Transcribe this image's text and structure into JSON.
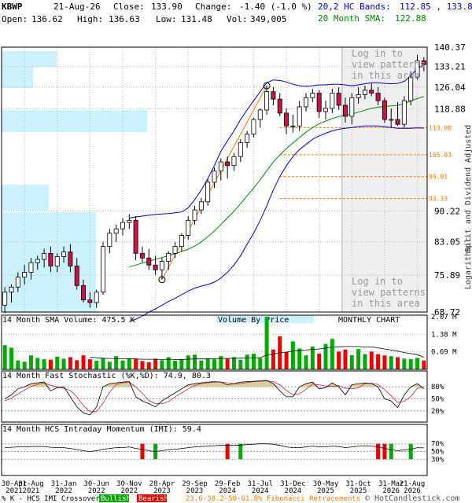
{
  "header": {
    "symbol": "KBWP",
    "date": "21-Aug-26",
    "close_label": "Close:",
    "close": "133.90",
    "change_label": "Change:",
    "change": "-1.40 (-1.0 %)",
    "open_label": "Open:",
    "open": "136.62",
    "high_label": "High:",
    "high": "136.63",
    "low_label": "Low:",
    "low": "131.48",
    "vol_label": "Vol:",
    "vol": "349,005",
    "bands_label": "20,2 HC Bands:",
    "bands_value": "112.85 , 133.81",
    "sma_label": "20 Month SMA:",
    "sma_value": "122.88"
  },
  "colors": {
    "up": "#00aa00",
    "down": "#ee0000",
    "candle_down": "#cc1144",
    "band": "#0000cc",
    "sma": "#008800",
    "fib": "#ff7700",
    "vbp": "#ccf2ff",
    "shade": "#efefef",
    "watermark": "#999999",
    "grid": "#bbbbbb"
  },
  "watermark": {
    "top": [
      "Log in to",
      "view patterns",
      "in this area"
    ],
    "bottom": [
      "Log in to",
      "view patterns",
      "in this area"
    ]
  },
  "side_labels": {
    "right": "Split and Dividend Adjusted",
    "scale": "Logarithmic"
  },
  "chart_data": [
    {
      "type": "candlestick",
      "panel": "price",
      "scale": "log",
      "ylim": [
        68.72,
        140.37
      ],
      "y_ticks": [
        "140.37",
        "133.21",
        "126.04",
        "118.88",
        "90.22",
        "83.05",
        "75.89",
        "68.72"
      ],
      "fib_labels": [
        "113.00",
        "105.03",
        "99.01",
        "93.33"
      ],
      "fib_values": [
        113.0,
        105.03,
        99.01,
        93.33
      ],
      "x": [
        "Apr 2021",
        "May 2021",
        "Jun 2021",
        "Jul 2021",
        "Aug 2021",
        "Sep 2021",
        "Oct 2021",
        "Nov 2021",
        "Dec 2021",
        "Jan 2022",
        "Feb 2022",
        "Mar 2022",
        "Apr 2022",
        "May 2022",
        "Jun 2022",
        "Jul 2022",
        "Aug 2022",
        "Sep 2022",
        "Oct 2022",
        "Nov 2022",
        "Dec 2022",
        "Jan 2023",
        "Feb 2023",
        "Mar 2023",
        "Apr 2023",
        "May 2023",
        "Jun 2023",
        "Jul 2023",
        "Aug 2023",
        "Sep 2023",
        "Oct 2023",
        "Nov 2023",
        "Dec 2023",
        "Jan 2024",
        "Feb 2024",
        "Mar 2024",
        "Apr 2024",
        "May 2024",
        "Jun 2024",
        "Jul 2024",
        "Aug 2024",
        "Sep 2024",
        "Oct 2024",
        "Nov 2024",
        "Dec 2024",
        "Jan 2025",
        "Feb 2025",
        "Mar 2025",
        "Apr 2025",
        "May 2025",
        "Jun 2025",
        "Jul 2025",
        "Aug 2025",
        "Sep 2025",
        "Oct 2025",
        "Nov 2025",
        "Dec 2025",
        "Jan 2026",
        "Feb 2026",
        "Mar 2026",
        "Apr 2026",
        "May 2026",
        "Jun 2026",
        "Jul 2026",
        "Aug 2026"
      ],
      "open": [
        70.0,
        72.5,
        73.5,
        75.5,
        76.5,
        78.5,
        79.2,
        80.5,
        77.8,
        79.8,
        80.8,
        77.8,
        73.8,
        71.0,
        70.5,
        72.5,
        82.0,
        85.0,
        86.0,
        87.5,
        88.0,
        80.5,
        79.5,
        78.0,
        77.0,
        78.8,
        80.5,
        82.0,
        84.5,
        88.0,
        90.5,
        92.5,
        97.5,
        100.5,
        103.0,
        102.0,
        104.5,
        108.5,
        111.0,
        115.5,
        118.5,
        124.5,
        122.0,
        117.5,
        113.5,
        113.5,
        119.5,
        122.5,
        124.0,
        118.0,
        119.0,
        124.0,
        120.0,
        116.5,
        122.5,
        123.5,
        125.0,
        124.0,
        121.5,
        115.5,
        115.5,
        114.0,
        121.5,
        129.5,
        135.3
      ],
      "high": [
        73.5,
        74.0,
        76.5,
        78.0,
        79.5,
        80.0,
        81.5,
        82.0,
        80.5,
        82.0,
        82.5,
        79.5,
        75.0,
        72.5,
        73.0,
        83.0,
        86.0,
        87.0,
        88.5,
        89.5,
        89.0,
        82.0,
        81.5,
        80.0,
        79.5,
        81.0,
        83.0,
        85.0,
        89.0,
        91.5,
        93.5,
        98.5,
        101.5,
        104.0,
        104.5,
        105.5,
        109.5,
        112.0,
        116.0,
        119.0,
        126.5,
        126.0,
        124.0,
        119.0,
        117.0,
        121.5,
        124.0,
        125.5,
        125.0,
        121.5,
        125.5,
        126.0,
        122.5,
        124.0,
        126.0,
        126.5,
        127.5,
        126.0,
        122.5,
        119.0,
        121.0,
        123.0,
        131.5,
        137.5,
        136.6
      ],
      "low": [
        68.5,
        70.5,
        72.5,
        74.0,
        75.0,
        77.0,
        77.5,
        76.5,
        76.5,
        78.5,
        76.5,
        73.0,
        70.5,
        69.5,
        69.5,
        72.0,
        80.5,
        83.0,
        84.5,
        86.0,
        79.0,
        78.5,
        77.0,
        76.0,
        75.0,
        77.0,
        79.5,
        81.0,
        83.5,
        87.0,
        89.5,
        91.5,
        96.0,
        98.0,
        98.5,
        100.5,
        103.0,
        107.0,
        110.0,
        113.0,
        117.0,
        120.0,
        116.5,
        111.0,
        111.5,
        112.0,
        118.0,
        121.0,
        116.0,
        115.5,
        117.5,
        118.5,
        114.5,
        114.0,
        120.5,
        122.0,
        123.0,
        120.0,
        114.5,
        113.0,
        113.5,
        113.0,
        120.0,
        128.5,
        131.5
      ],
      "close": [
        72.5,
        73.5,
        75.5,
        76.5,
        78.5,
        79.2,
        80.5,
        77.8,
        79.8,
        80.8,
        77.8,
        73.8,
        71.0,
        70.5,
        72.5,
        82.0,
        85.0,
        86.0,
        87.5,
        88.0,
        80.5,
        79.5,
        78.0,
        77.0,
        78.8,
        80.5,
        82.0,
        84.5,
        88.0,
        90.5,
        92.5,
        97.5,
        100.5,
        103.0,
        102.0,
        104.5,
        108.5,
        111.0,
        115.5,
        118.5,
        124.5,
        122.0,
        117.5,
        113.5,
        113.5,
        119.5,
        122.5,
        124.0,
        118.0,
        119.0,
        124.0,
        120.0,
        116.5,
        122.5,
        123.5,
        125.0,
        124.0,
        121.5,
        115.5,
        115.5,
        114.0,
        121.5,
        129.5,
        135.3,
        133.9
      ],
      "sma20": [
        null,
        null,
        null,
        null,
        null,
        null,
        null,
        null,
        null,
        null,
        null,
        null,
        null,
        null,
        null,
        null,
        null,
        null,
        null,
        77.6,
        78.0,
        78.4,
        78.8,
        79.2,
        79.6,
        80.0,
        80.4,
        80.9,
        81.4,
        82.1,
        83.0,
        84.2,
        85.5,
        87.0,
        88.6,
        90.2,
        92.0,
        94.0,
        96.0,
        98.2,
        100.6,
        103.0,
        105.0,
        106.8,
        108.4,
        110.0,
        111.6,
        113.0,
        114.2,
        115.0,
        115.8,
        116.4,
        116.8,
        117.2,
        117.8,
        118.4,
        119.0,
        119.4,
        119.6,
        119.8,
        120.0,
        120.6,
        121.4,
        122.2,
        122.9
      ],
      "band_upper": [
        null,
        null,
        null,
        null,
        null,
        null,
        null,
        null,
        null,
        null,
        null,
        null,
        null,
        null,
        null,
        null,
        null,
        null,
        null,
        88.5,
        88.8,
        89.0,
        89.2,
        89.4,
        89.5,
        89.6,
        89.8,
        90.0,
        91.0,
        93.0,
        95.5,
        98.5,
        102.0,
        106.0,
        109.0,
        112.0,
        115.5,
        118.5,
        121.5,
        124.5,
        127.5,
        128.5,
        128.3,
        127.8,
        127.0,
        126.5,
        126.3,
        126.5,
        126.8,
        126.8,
        127.0,
        127.0,
        126.8,
        126.5,
        126.8,
        127.2,
        127.5,
        127.5,
        127.3,
        127.2,
        127.3,
        128.0,
        130.0,
        132.5,
        133.8
      ],
      "band_lower": [
        null,
        null,
        null,
        null,
        null,
        null,
        null,
        null,
        null,
        null,
        null,
        null,
        null,
        null,
        null,
        null,
        null,
        null,
        null,
        67.0,
        67.4,
        68.0,
        68.7,
        69.3,
        70.0,
        70.7,
        71.3,
        72.0,
        72.7,
        73.3,
        73.7,
        74.0,
        74.5,
        75.3,
        76.5,
        78.0,
        80.0,
        82.5,
        85.0,
        88.0,
        91.5,
        95.5,
        99.0,
        102.0,
        104.5,
        106.5,
        108.0,
        109.5,
        110.5,
        111.3,
        112.0,
        112.5,
        112.8,
        113.0,
        113.3,
        113.5,
        113.5,
        113.5,
        113.3,
        113.0,
        112.8,
        112.8,
        112.8,
        112.9,
        112.85
      ],
      "x_ticks": [
        "30-Apr\n2021",
        "31-Aug\n2021",
        "31-Jan\n2022",
        "30-Jun\n2022",
        "30-Nov\n2022",
        "28-Apr\n2023",
        "29-Sep\n2023",
        "29-Feb\n2024",
        "31-Jul\n2024",
        "31-Dec\n2024",
        "30-May\n2025",
        "31-Oct\n2025",
        "31-Mar\n2026",
        "21-Aug\n2026"
      ]
    },
    {
      "type": "bar",
      "panel": "volume",
      "title": "14 Month SMA Volume: 475.5 K",
      "label_center": "Volume By Price",
      "label_right": "MONTHLY CHART",
      "y_ticks": [
        "2.07 M",
        "1.38 M",
        "0.69 M"
      ],
      "ylim": [
        0,
        2.07
      ],
      "values": [
        0.95,
        0.85,
        0.35,
        0.3,
        0.55,
        0.45,
        0.4,
        0.38,
        0.5,
        0.42,
        0.48,
        0.36,
        0.55,
        0.4,
        0.34,
        0.45,
        0.3,
        0.52,
        0.35,
        0.44,
        0.4,
        0.33,
        0.28,
        0.42,
        0.36,
        0.48,
        0.34,
        0.4,
        0.55,
        0.58,
        0.35,
        0.44,
        0.4,
        0.52,
        0.42,
        0.48,
        0.38,
        0.58,
        0.62,
        0.44,
        2.07,
        0.78,
        1.3,
        0.68,
        1.1,
        0.82,
        0.55,
        0.9,
        0.62,
        1.0,
        1.2,
        0.7,
        0.78,
        0.56,
        0.8,
        0.6,
        0.7,
        0.6,
        0.55,
        0.52,
        0.48,
        0.42,
        0.4,
        0.45,
        0.35
      ],
      "sma14": [
        null,
        null,
        null,
        null,
        null,
        null,
        null,
        null,
        null,
        null,
        null,
        null,
        null,
        0.48,
        0.46,
        0.44,
        0.43,
        0.42,
        0.42,
        0.42,
        0.41,
        0.4,
        0.4,
        0.4,
        0.39,
        0.4,
        0.39,
        0.39,
        0.4,
        0.41,
        0.41,
        0.41,
        0.42,
        0.43,
        0.43,
        0.44,
        0.44,
        0.45,
        0.46,
        0.46,
        0.57,
        0.6,
        0.66,
        0.68,
        0.72,
        0.75,
        0.76,
        0.79,
        0.8,
        0.84,
        0.88,
        0.89,
        0.9,
        0.9,
        0.9,
        0.88,
        0.88,
        0.85,
        0.8,
        0.76,
        0.72,
        0.66,
        0.62,
        0.58,
        0.48
      ]
    },
    {
      "type": "line",
      "panel": "stochastic",
      "title": "14 Month Fast Stochastic (%K,%D): 74.9, 80.3",
      "y_ticks": [
        "80%",
        "50%",
        "20%"
      ],
      "ylim": [
        0,
        100
      ],
      "k": [
        50,
        60,
        75,
        80,
        88,
        90,
        92,
        70,
        78,
        80,
        55,
        30,
        15,
        10,
        30,
        80,
        88,
        90,
        92,
        93,
        55,
        45,
        38,
        30,
        45,
        55,
        65,
        75,
        85,
        88,
        90,
        92,
        93,
        92,
        85,
        88,
        92,
        93,
        94,
        95,
        96,
        88,
        70,
        55,
        55,
        80,
        88,
        92,
        75,
        78,
        90,
        80,
        60,
        85,
        88,
        90,
        88,
        80,
        50,
        45,
        28,
        60,
        80,
        88,
        74.9
      ],
      "d": [
        45,
        52,
        62,
        72,
        81,
        86,
        90,
        84,
        80,
        76,
        71,
        55,
        33,
        18,
        18,
        40,
        66,
        86,
        90,
        92,
        80,
        64,
        46,
        38,
        38,
        43,
        55,
        65,
        75,
        83,
        88,
        90,
        92,
        92,
        90,
        88,
        88,
        91,
        93,
        94,
        95,
        93,
        85,
        71,
        60,
        63,
        74,
        87,
        85,
        82,
        81,
        83,
        77,
        75,
        78,
        88,
        89,
        86,
        73,
        58,
        41,
        44,
        56,
        76,
        80.3
      ]
    },
    {
      "type": "bar",
      "panel": "momentum",
      "title": "14 Month HCS Intraday Momentum (IMI): 59.4",
      "y_ticks": [
        "70%",
        "50%",
        "30%"
      ],
      "ylim": [
        0,
        100
      ],
      "imi_line": [
        60,
        61,
        62,
        62,
        63,
        63,
        63,
        61,
        60,
        60,
        58,
        55,
        52,
        50,
        52,
        56,
        58,
        60,
        60,
        62,
        58,
        56,
        52,
        50,
        52,
        55,
        56,
        58,
        60,
        62,
        63,
        64,
        65,
        66,
        66,
        66,
        67,
        68,
        69,
        70,
        70,
        69,
        66,
        62,
        60,
        60,
        62,
        64,
        62,
        62,
        64,
        63,
        60,
        62,
        64,
        65,
        64,
        62,
        58,
        55,
        52,
        54,
        56,
        60,
        59.4
      ],
      "crossover_bull_idx": [
        23,
        36,
        59,
        62
      ],
      "crossover_bear_idx": [
        21,
        34,
        58,
        57
      ]
    }
  ],
  "footer": {
    "crossover_text": "% K - HCS IMI Crossover:",
    "bullish": "Bullish",
    "bearish": "Bearish",
    "fib_text": "23.6-38.2-50-61.8% Fibonacci Retracements",
    "copyright": "© HotCandlestick.com"
  }
}
